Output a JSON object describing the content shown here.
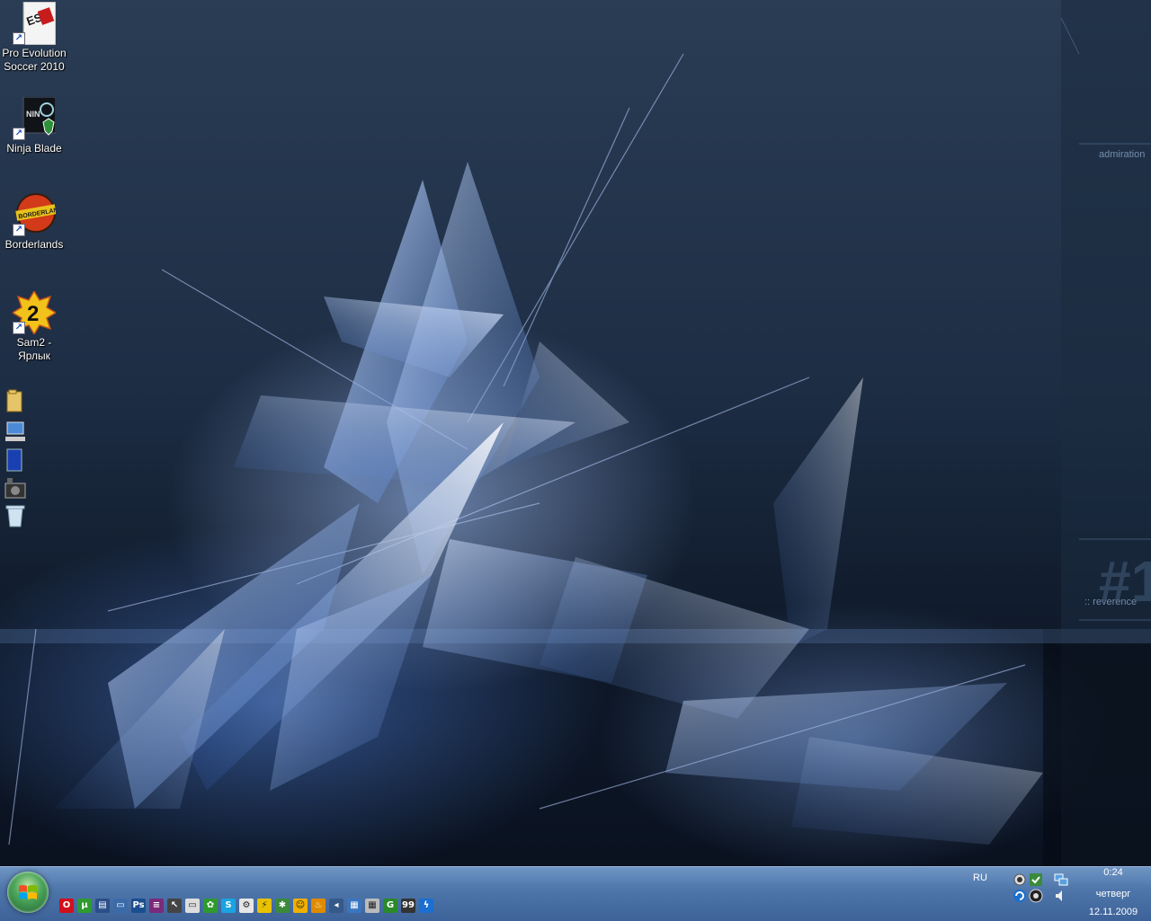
{
  "desktop": {
    "icons": [
      {
        "label": "Pro Evolution Soccer 2010",
        "icon": "pes-2010-icon"
      },
      {
        "label": "Ninja Blade",
        "icon": "ninja-blade-icon"
      },
      {
        "label": "Borderlands",
        "icon": "borderlands-icon",
        "logo_text": "BORDERLANDS"
      },
      {
        "label": "Sam2 - Ярлык",
        "icon": "serious-sam-2-icon",
        "logo_text": "2"
      }
    ],
    "side_icons": [
      "folder-icon",
      "computer-icon",
      "monitor-icon",
      "camera-icon",
      "recycle-bin-icon"
    ]
  },
  "wallpaper": {
    "texts": {
      "admiration": "admiration",
      "reverence": ":: reverence",
      "number": "#1"
    }
  },
  "taskbar": {
    "quick_launch": [
      {
        "icon": "opera-icon",
        "color": "#d0101a",
        "glyph": "O"
      },
      {
        "icon": "utorrent-icon",
        "color": "#2f9a2f",
        "glyph": "µ"
      },
      {
        "icon": "show-desktop-icon",
        "color": "#2a4f8a",
        "glyph": "▤"
      },
      {
        "icon": "window-switcher-icon",
        "color": "#3b6aa8",
        "glyph": "▭"
      },
      {
        "icon": "photoshop-icon",
        "color": "#1b4e8f",
        "glyph": "Ps"
      },
      {
        "icon": "table-app-icon",
        "color": "#7a2a7a",
        "glyph": "≡"
      },
      {
        "icon": "arrow-app-icon",
        "color": "#444",
        "glyph": "↖"
      },
      {
        "icon": "media-player-icon",
        "color": "#dddddd",
        "glyph": "▭"
      },
      {
        "icon": "icq-icon",
        "color": "#2e9a2e",
        "glyph": "✿"
      },
      {
        "icon": "skype-icon",
        "color": "#1aa3e0",
        "glyph": "S"
      },
      {
        "icon": "steam-icon",
        "color": "#e6e6e6",
        "glyph": "⚙"
      },
      {
        "icon": "winamp-icon",
        "color": "#e6c200",
        "glyph": "⚡"
      },
      {
        "icon": "gear-app-icon",
        "color": "#3a8a3a",
        "glyph": "✱"
      },
      {
        "icon": "smiley-icon",
        "color": "#f0b000",
        "glyph": "☺"
      },
      {
        "icon": "torch-icon",
        "color": "#e08a00",
        "glyph": "♨"
      },
      {
        "icon": "sound-app-icon",
        "color": "#355a8a",
        "glyph": "◂"
      },
      {
        "icon": "database-icon",
        "color": "#3a76c0",
        "glyph": "▦"
      },
      {
        "icon": "calculator-icon",
        "color": "#bbbbbb",
        "glyph": "▦"
      },
      {
        "icon": "everest-icon",
        "color": "#2a8a2a",
        "glyph": "G"
      },
      {
        "icon": "counter-icon",
        "color": "#333",
        "glyph": "99"
      },
      {
        "icon": "lightning-app-icon",
        "color": "#1a6fd0",
        "glyph": "ϟ"
      }
    ],
    "language": "RU",
    "clock": {
      "time": "0:24",
      "day": "четверг",
      "date": "12.11.2009"
    }
  }
}
